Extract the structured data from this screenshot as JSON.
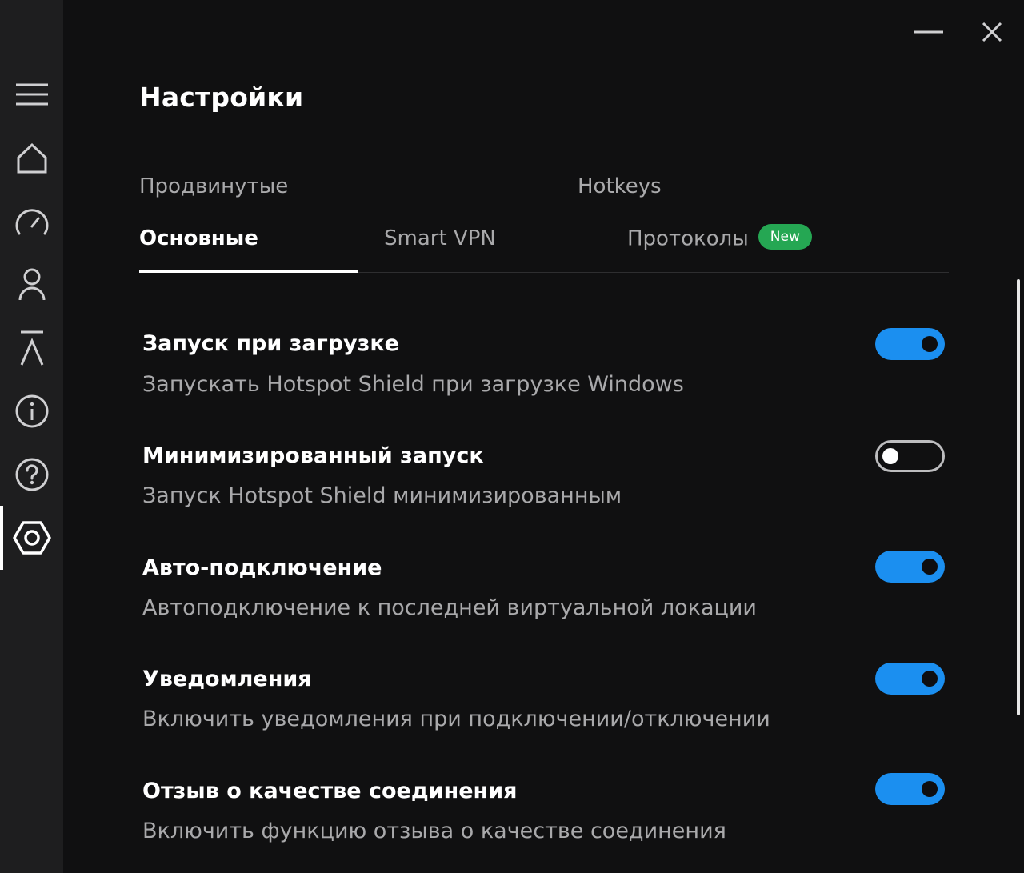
{
  "colors": {
    "background": "#101011",
    "sidebar": "#1e1e1f",
    "toggle_on": "#1b8ff0",
    "badge_new": "#25a753",
    "secondary_text": "#a9a9ab"
  },
  "window_controls": {
    "minimize_icon": "minimize-icon",
    "close_icon": "close-icon"
  },
  "sidebar": {
    "items": [
      {
        "icon": "menu-icon",
        "active": false
      },
      {
        "icon": "home-icon",
        "active": false
      },
      {
        "icon": "speedometer-icon",
        "active": false
      },
      {
        "icon": "user-icon",
        "active": false
      },
      {
        "icon": "upload-icon",
        "active": false
      },
      {
        "icon": "info-icon",
        "active": false
      },
      {
        "icon": "help-icon",
        "active": false
      },
      {
        "icon": "settings-icon",
        "active": true
      }
    ]
  },
  "page": {
    "title": "Настройки"
  },
  "tabs": {
    "row1": [
      {
        "label": "Продвинутые"
      },
      {
        "label": "Hotkeys"
      }
    ],
    "row2": [
      {
        "label": "Основные",
        "active": true
      },
      {
        "label": "Smart VPN",
        "active": false
      },
      {
        "label": "Протоколы",
        "active": false,
        "badge": "New"
      }
    ]
  },
  "settings": [
    {
      "title": "Запуск при загрузке",
      "description": "Запускать Hotspot Shield при загрузке Windows",
      "enabled": true
    },
    {
      "title": "Минимизированный запуск",
      "description": "Запуск Hotspot Shield минимизированным",
      "enabled": false
    },
    {
      "title": "Авто-подключение",
      "description": "Автоподключение к последней виртуальной локации",
      "enabled": true
    },
    {
      "title": "Уведомления",
      "description": "Включить уведомления при подключении/отключении",
      "enabled": true
    },
    {
      "title": "Отзыв о качестве соединения",
      "description": "Включить функцию отзыва о качестве соединения",
      "enabled": true
    }
  ]
}
